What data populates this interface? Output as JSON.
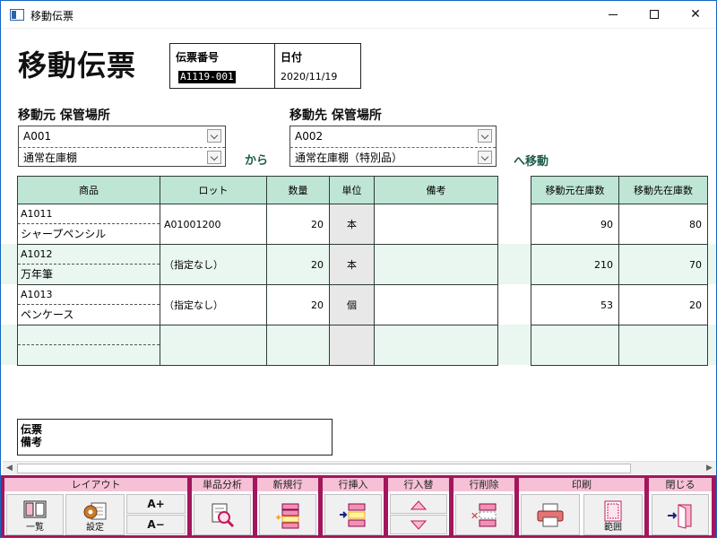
{
  "window": {
    "title": "移動伝票"
  },
  "heading": "移動伝票",
  "header": {
    "slip_no_label": "伝票番号",
    "slip_no": "A1119-001",
    "date_label": "日付",
    "date": "2020/11/19"
  },
  "source": {
    "label": "移動元  保管場所",
    "location": "A001",
    "shelf": "通常在庫棚"
  },
  "destination": {
    "label": "移動先  保管場所",
    "location": "A002",
    "shelf": "通常在庫棚（特別品）"
  },
  "from_text": "から",
  "to_text": "へ移動",
  "grid": {
    "headers": {
      "product": "商品",
      "lot": "ロット",
      "qty": "数量",
      "unit": "単位",
      "note": "備考",
      "src_stock": "移動元在庫数",
      "dst_stock": "移動先在庫数"
    },
    "rows": [
      {
        "code": "A1011",
        "name": "シャープペンシル",
        "lot": "A01001200",
        "qty": "20",
        "unit": "本",
        "note": "",
        "src": "90",
        "dst": "80"
      },
      {
        "code": "A1012",
        "name": "万年筆",
        "lot": "（指定なし）",
        "qty": "20",
        "unit": "本",
        "note": "",
        "src": "210",
        "dst": "70"
      },
      {
        "code": "A1013",
        "name": "ペンケース",
        "lot": "（指定なし）",
        "qty": "20",
        "unit": "個",
        "note": "",
        "src": "53",
        "dst": "20"
      },
      {
        "code": "",
        "name": "",
        "lot": "",
        "qty": "",
        "unit": "",
        "note": "",
        "src": "",
        "dst": ""
      }
    ]
  },
  "remark": {
    "label_line1": "伝票",
    "label_line2": "備考"
  },
  "toolbar": {
    "layout": {
      "title": "レイアウト",
      "list": "一覧",
      "settings": "設定",
      "font_up": "A+",
      "font_down": "A−"
    },
    "analysis": {
      "title": "単品分析"
    },
    "new_row": {
      "title": "新規行"
    },
    "insert_row": {
      "title": "行挿入"
    },
    "swap_row": {
      "title": "行入替"
    },
    "delete_row": {
      "title": "行削除"
    },
    "print": {
      "title": "印刷",
      "range": "範囲"
    },
    "close": {
      "title": "閉じる"
    }
  },
  "colors": {
    "toolbar_bg": "#a3165d",
    "group_title_bg": "#f6c1d6",
    "grid_header": "#bfe5d5",
    "row_stripe": "#eaf6f0",
    "accent_text": "#1d5b4a"
  }
}
